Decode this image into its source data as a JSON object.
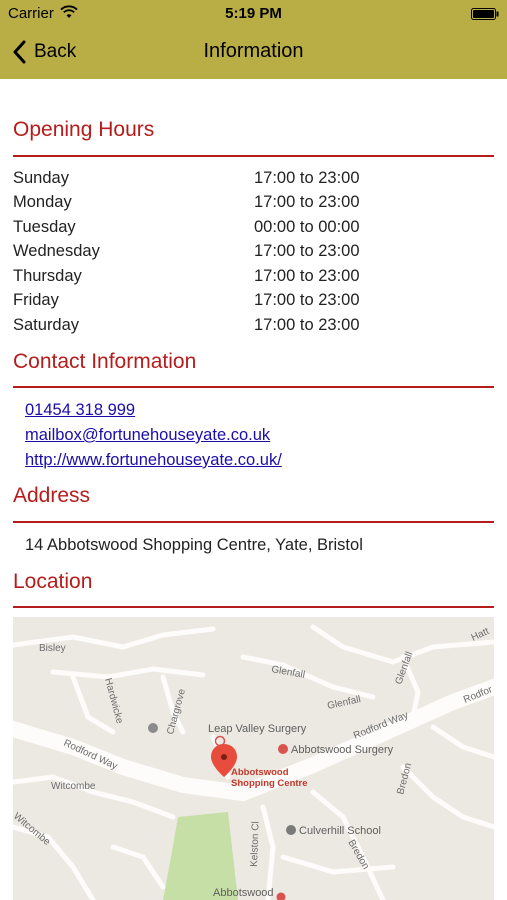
{
  "status_bar": {
    "carrier": "Carrier",
    "time": "5:19 PM"
  },
  "nav": {
    "back_label": "Back",
    "title": "Information"
  },
  "sections": {
    "opening_hours": "Opening Hours",
    "contact": "Contact Information",
    "address": "Address",
    "location": "Location"
  },
  "opening_hours": [
    {
      "day": "Sunday",
      "time": "17:00 to 23:00"
    },
    {
      "day": "Monday",
      "time": "17:00 to 23:00"
    },
    {
      "day": "Tuesday",
      "time": "00:00 to 00:00"
    },
    {
      "day": "Wednesday",
      "time": "17:00 to 23:00"
    },
    {
      "day": "Thursday",
      "time": "17:00 to 23:00"
    },
    {
      "day": "Friday",
      "time": "17:00 to 23:00"
    },
    {
      "day": "Saturday",
      "time": "17:00 to 23:00"
    }
  ],
  "contact": {
    "phone": "01454 318 999",
    "email": "mailbox@fortunehouseyate.co.uk",
    "website": "http://www.fortunehouseyate.co.uk/"
  },
  "address": "14 Abbotswood Shopping Centre, Yate, Bristol",
  "map": {
    "labels": {
      "bisley": "Bisley",
      "hatt": "Hatt",
      "glenfall_1": "Glenfall",
      "glenfall_2": "Glenfall",
      "glenfall_3": "Glenfall",
      "hardwicke": "Hardwicke",
      "chargrove": "Chargrove",
      "rodford_way_left": "Rodford Way",
      "rodford_way_mid": "Rodford Way",
      "rodford_right": "Rodfor",
      "witcombe_1": "Witcombe",
      "witcombe_2": "Witcombe",
      "bredon_1": "Bredon",
      "bredon_2": "Bredon",
      "kelston_cl": "Kelston Cl"
    },
    "pois": {
      "leap_valley": "Leap Valley Surgery",
      "abbotswood_surgery": "Abbotswood Surgery",
      "culverhill": "Culverhill School",
      "abbotswood_bottom": "Abbotswood"
    },
    "marker": {
      "line1": "Abbotswood",
      "line2": "Shopping Centre"
    }
  },
  "colors": {
    "nav_bar": "#b9ae45",
    "accent_red": "#b71c1c",
    "link_blue": "#1a0dab"
  }
}
